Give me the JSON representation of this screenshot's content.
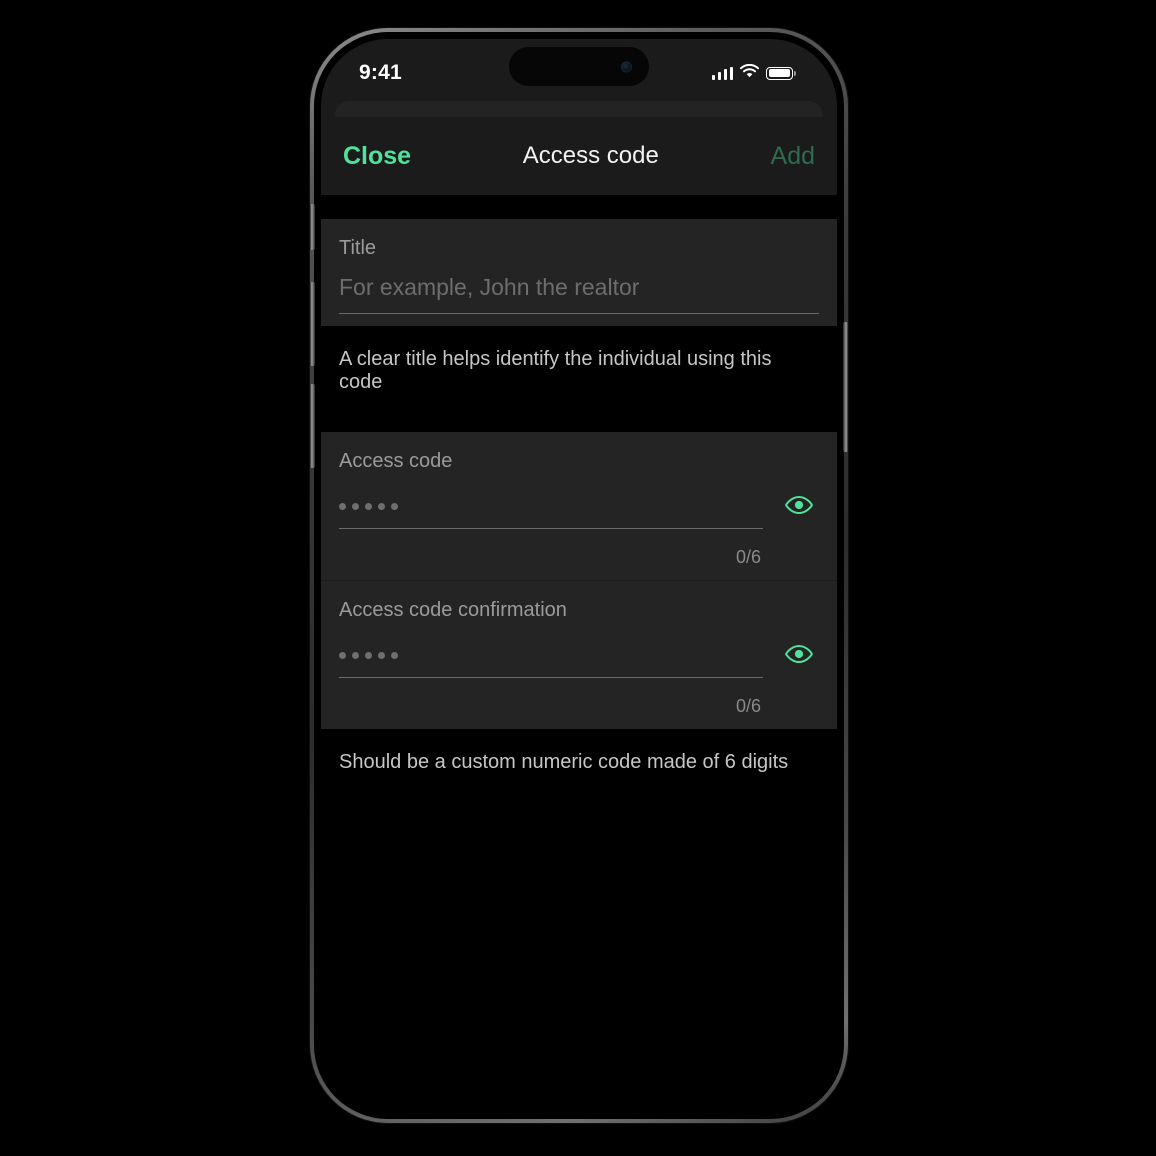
{
  "device": {
    "buttons": [
      "action-button",
      "volume-up-button",
      "volume-down-button",
      "power-button"
    ]
  },
  "status_bar": {
    "time": "9:41",
    "cellular_icon": "cellular-bars-icon",
    "wifi_icon": "wifi-icon",
    "battery_icon": "battery-full-icon",
    "dynamic_island": "dynamic-island"
  },
  "nav": {
    "close_label": "Close",
    "title": "Access code",
    "add_label": "Add",
    "accent_color": "#4ee29a",
    "add_disabled_color": "#2f6a51"
  },
  "title_section": {
    "label": "Title",
    "placeholder": "For example, John the realtor",
    "value": "",
    "helper": "A clear title helps identify the individual using this code"
  },
  "code_section": {
    "fields": [
      {
        "label": "Access code",
        "value": "",
        "masked_dots": 5,
        "counter": "0/6",
        "reveal_icon": "eye-icon"
      },
      {
        "label": "Access code confirmation",
        "value": "",
        "masked_dots": 5,
        "counter": "0/6",
        "reveal_icon": "eye-icon"
      }
    ],
    "helper": "Should be a custom numeric code made of 6 digits"
  }
}
